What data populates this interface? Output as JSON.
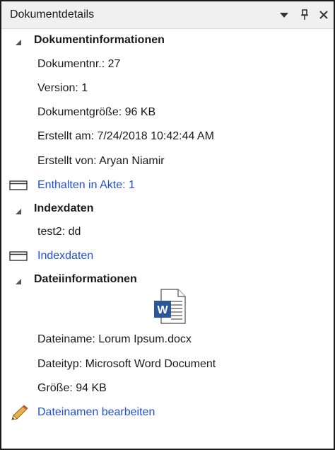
{
  "panel": {
    "title": "Dokumentdetails",
    "icons": [
      "dropdown-icon",
      "pin-icon",
      "close-icon"
    ]
  },
  "document_info": {
    "header": "Dokumentinformationen",
    "doc_number": "Dokumentnr.: 27",
    "version": "Version: 1",
    "doc_size": "Dokumentgröße: 96 KB",
    "created_at": "Erstellt am: 7/24/2018 10:42:44 AM",
    "created_by": "Erstellt von: Aryan Niamir",
    "contained_link": "Enthalten in Akte: 1"
  },
  "index_data": {
    "header": "Indexdaten",
    "field": "test2:  dd",
    "link": "Indexdaten"
  },
  "file_info": {
    "header": "Dateiinformationen",
    "file_icon": "word-document-icon",
    "file_name": "Dateiname: Lorum Ipsum.docx",
    "file_type": "Dateityp: Microsoft Word Document",
    "file_size": "Größe: 94 KB",
    "rename_link": "Dateinamen bearbeiten"
  },
  "colors": {
    "link": "#1f4fd6",
    "word_blue": "#2b5797"
  }
}
